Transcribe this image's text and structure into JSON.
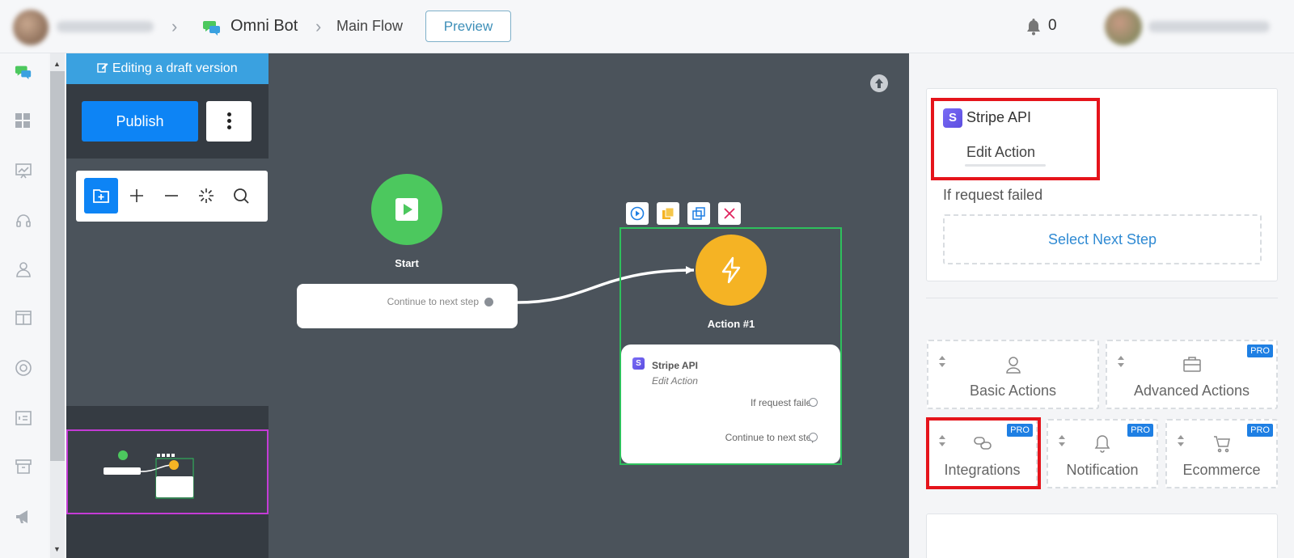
{
  "header": {
    "bot_name": "Omni Bot",
    "flow_name": "Main Flow",
    "preview_label": "Preview",
    "notification_count": "0"
  },
  "left_panel": {
    "draft_banner": "Editing a draft version",
    "publish_label": "Publish"
  },
  "canvas": {
    "start_label": "Start",
    "start_continue": "Continue to next step",
    "action_label": "Action #1",
    "action_card": {
      "title": "Stripe API",
      "subtitle": "Edit Action",
      "if_failed": "If request failed",
      "continue": "Continue to next step"
    }
  },
  "right_panel": {
    "integration_title": "Stripe API",
    "edit_action": "Edit Action",
    "if_request_failed": "If request failed",
    "select_next_step": "Select Next Step",
    "categories": [
      {
        "label": "Basic Actions",
        "pro": ""
      },
      {
        "label": "Advanced Actions",
        "pro": "PRO"
      },
      {
        "label": "Integrations",
        "pro": "PRO"
      },
      {
        "label": "Notification",
        "pro": "PRO"
      },
      {
        "label": "Ecommerce",
        "pro": "PRO"
      }
    ]
  },
  "colors": {
    "accent": "#0d84f5",
    "start_green": "#4cc85e",
    "action_yellow": "#f5b324",
    "highlight_red": "#e5141b",
    "selection_green": "#2ec05c",
    "minimap_magenta": "#c43bd6"
  }
}
